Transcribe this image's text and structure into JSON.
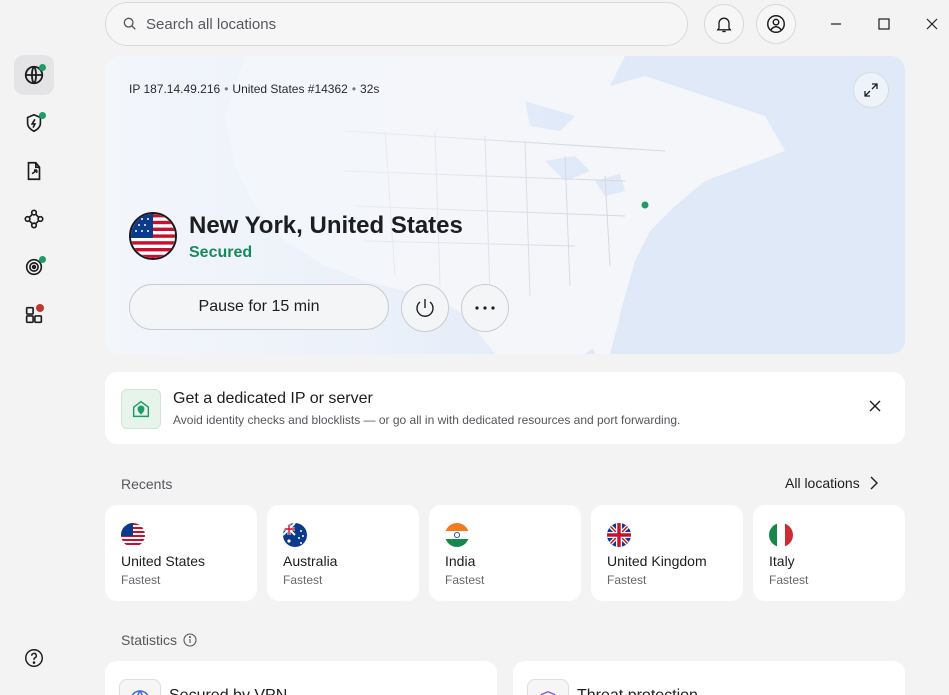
{
  "search": {
    "placeholder": "Search all locations"
  },
  "sidebar": {
    "items": [
      {
        "name": "globe-icon",
        "active": true
      },
      {
        "name": "threat-protection-icon"
      },
      {
        "name": "file-share-icon"
      },
      {
        "name": "meshnet-icon"
      },
      {
        "name": "dark-web-monitor-icon"
      },
      {
        "name": "apps-icon"
      }
    ],
    "help_icon": "help-icon"
  },
  "connection": {
    "ip_label": "IP 187.14.49.216",
    "server": "United States #14362",
    "duration": "32s",
    "location": "New York, United States",
    "status": "Secured",
    "pause_label": "Pause for 15 min",
    "status_color": "#178a5c"
  },
  "promo": {
    "title": "Get a dedicated IP or server",
    "subtitle": "Avoid identity checks and blocklists — or go all in with dedicated resources and port forwarding."
  },
  "recents": {
    "label": "Recents",
    "all_locations": "All locations",
    "items": [
      {
        "country": "United States",
        "sub": "Fastest",
        "flag": "us"
      },
      {
        "country": "Australia",
        "sub": "Fastest",
        "flag": "au"
      },
      {
        "country": "India",
        "sub": "Fastest",
        "flag": "in"
      },
      {
        "country": "United Kingdom",
        "sub": "Fastest",
        "flag": "uk"
      },
      {
        "country": "Italy",
        "sub": "Fastest",
        "flag": "it"
      }
    ]
  },
  "statistics": {
    "label": "Statistics",
    "cards": [
      {
        "title": "Secured by VPN"
      },
      {
        "title": "Threat protection"
      }
    ]
  }
}
